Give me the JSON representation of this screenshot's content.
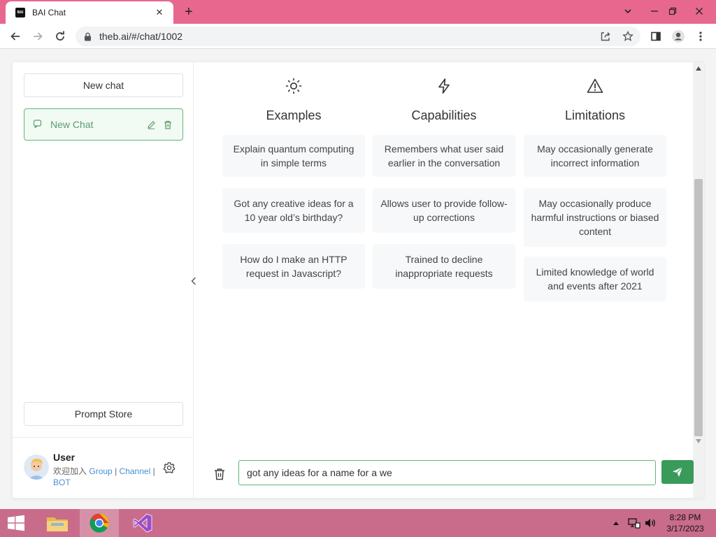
{
  "browser": {
    "tab_title": "BAI Chat",
    "tab_favicon_text": "BAI",
    "url": "theb.ai/#/chat/1002"
  },
  "sidebar": {
    "new_chat_label": "New chat",
    "chats": [
      {
        "label": "New Chat"
      }
    ],
    "prompt_store_label": "Prompt Store",
    "user": {
      "name": "User",
      "join_text": "欢迎加入",
      "links": [
        "Group",
        "Channel",
        "BOT"
      ],
      "separator": "|"
    }
  },
  "columns": [
    {
      "title": "Examples",
      "icon": "sun-icon",
      "cards": [
        "Explain quantum computing in simple terms",
        "Got any creative ideas for a 10 year old’s birthday?",
        "How do I make an HTTP request in Javascript?"
      ]
    },
    {
      "title": "Capabilities",
      "icon": "lightning-icon",
      "cards": [
        "Remembers what user said earlier in the conversation",
        "Allows user to provide follow-up corrections",
        "Trained to decline inappropriate requests"
      ]
    },
    {
      "title": "Limitations",
      "icon": "warning-icon",
      "cards": [
        "May occasionally generate incorrect information",
        "May occasionally produce harmful instructions or biased content",
        "Limited knowledge of world and events after 2021"
      ]
    }
  ],
  "composer": {
    "input_value": "got any ideas for a name for a we"
  },
  "taskbar": {
    "time": "8:28 PM",
    "date": "3/17/2023"
  },
  "colors": {
    "browser_frame": "#e8678f",
    "accent_green": "#3a9a5a",
    "taskbar": "#c96c8c"
  }
}
